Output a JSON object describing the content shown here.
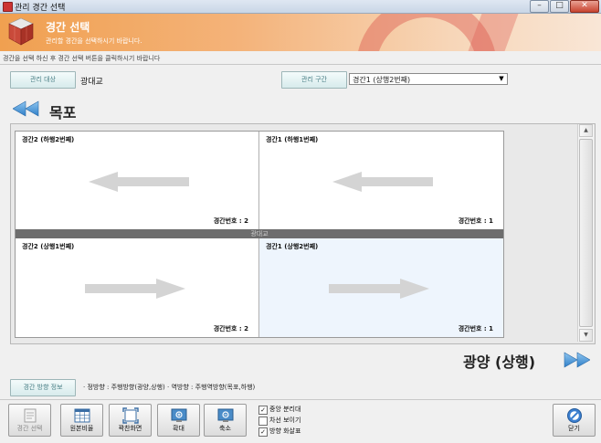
{
  "window": {
    "title": "관리 경간 선택",
    "min": "–",
    "max": "□",
    "close": "✕"
  },
  "banner": {
    "title": "경간 선택",
    "subtitle": "관리할 경간을 선택하시기 바랍니다."
  },
  "instruction": "경간을 선택 하신 후 경간 선택 버튼을 클릭하시기 바랍니다",
  "target": {
    "label": "관리 대상",
    "value": "광대교"
  },
  "section": {
    "label": "관리 구간",
    "selected": "경간1 (상행2번째)"
  },
  "destinations": {
    "left": "목포",
    "right": "광양 (상행)"
  },
  "median_label": "광대교",
  "spans": [
    {
      "title": "경간2 (하행2번째)",
      "number_label": "경간번호 : 2",
      "direction": "left",
      "selected": false
    },
    {
      "title": "경간1 (하행1번째)",
      "number_label": "경간번호 : 1",
      "direction": "left",
      "selected": false
    },
    {
      "title": "경간2 (상행1번째)",
      "number_label": "경간번호 : 2",
      "direction": "right",
      "selected": false
    },
    {
      "title": "경간1 (상행2번째)",
      "number_label": "경간번호 : 1",
      "direction": "right",
      "selected": true
    }
  ],
  "direction_info": {
    "label": "경간 방향 정보",
    "text": "· 정방향 : 주행방향(광양,상행) · 역방향 : 주행역방향(목포,하행)"
  },
  "toolbar": {
    "select": "경간 선택",
    "original": "원본비율",
    "fit": "꽉찬화면",
    "zoom_in": "확대",
    "zoom_out": "축소",
    "close": "닫기"
  },
  "options": [
    {
      "label": "중앙 분리대",
      "checked": true
    },
    {
      "label": "차선 보이기",
      "checked": false
    },
    {
      "label": "방향 화살표",
      "checked": true
    }
  ]
}
